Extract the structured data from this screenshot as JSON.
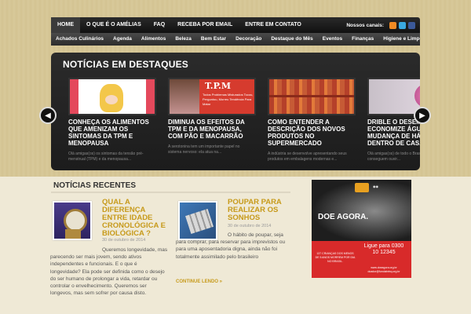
{
  "main_nav": {
    "items": [
      "HOME",
      "O QUE É O AMÉLIAS",
      "FAQ",
      "RECEBA POR EMAIL",
      "ENTRE EM CONTATO"
    ],
    "social_label": "Nossos canais:"
  },
  "category_nav": {
    "items": [
      "Achados Culinários",
      "Agenda",
      "Alimentos",
      "Beleza",
      "Bem Estar",
      "Decoração",
      "Destaque do Mês",
      "Eventos",
      "Finanças",
      "Higiene e Limpeza"
    ]
  },
  "featured": {
    "title": "NOTÍCIAS EM DESTAQUES",
    "slides": [
      {
        "title": "CONHEÇA OS ALIMENTOS QUE AMENIZAM OS SINTOMAS DA TPM E MENOPAUSA",
        "excerpt": "Olá amigas(os) os sintomas da tensão pré-menstrual (TPM) e da menopausa..."
      },
      {
        "title": "DIMINUA OS EFEITOS DA TPM E DA MENOPAUSA, COM PÃO E MACARRÃO",
        "excerpt": "A serotonina tem um importante papel no sistema nervoso: ela atua na..."
      },
      {
        "title": "COMO ENTENDER A DESCRIÇÃO DOS NOVOS PRODUTOS NO SUPERMERCADO",
        "excerpt": "A indústria se desenvolve apresentando seus produtos em embalagens modernas e..."
      },
      {
        "title": "DRIBLE O DESEMPREGO ECONOMIZE ÁGUA: MUDANÇA DE HÁBITOS DENTRO DE CASA",
        "excerpt": "Olá amigas(os) de todo o Brasil, não conseguem ouvir..."
      }
    ],
    "thumb_text": {
      "tpm": "T.P.M",
      "tpm_lines": "Todos Problemas Misturados Tocou, Perguntou, Morreu Tendência Para Matar"
    }
  },
  "recent": {
    "title": "NOTÍCIAS RECENTES",
    "posts": [
      {
        "title": "QUAL A DIFERENÇA ENTRE IDADE CRONOLÓGICA E BIOLÓGICA ?",
        "date": "30 de outubro de 2014",
        "excerpt": "Queremos longevidade, mas parecendo ser mais jovem, sendo ativos independentes e funcionais. E o que é longevidade? Ela pode ser definida como o desejo do ser humano de prolongar a vida, retardar ou controlar o envelhecimento. Queremos ser longevos, mas sem sofrer por causa disto."
      },
      {
        "title": "POUPAR PARA REALIZAR OS SONHOS",
        "date": "30 de outubro de 2014",
        "excerpt": "O hábito de poupar, seja para comprar, para reservar para imprevistos ou para uma aposentadoria digna, ainda não foi totalmente assimilado pelo brasileiro",
        "read_more": "CONTINUE LENDO »"
      }
    ]
  },
  "ad": {
    "headline": "DOE AGORA.",
    "cta": "Ligue para 0300 10 12345",
    "small_text": "137 CRIANÇAS DOS MENOS DE 5 ANOS MORREM POR DIA NO BRASIL.",
    "site": "www.doeagora.org.br doador@fundabrinq.org.br"
  }
}
